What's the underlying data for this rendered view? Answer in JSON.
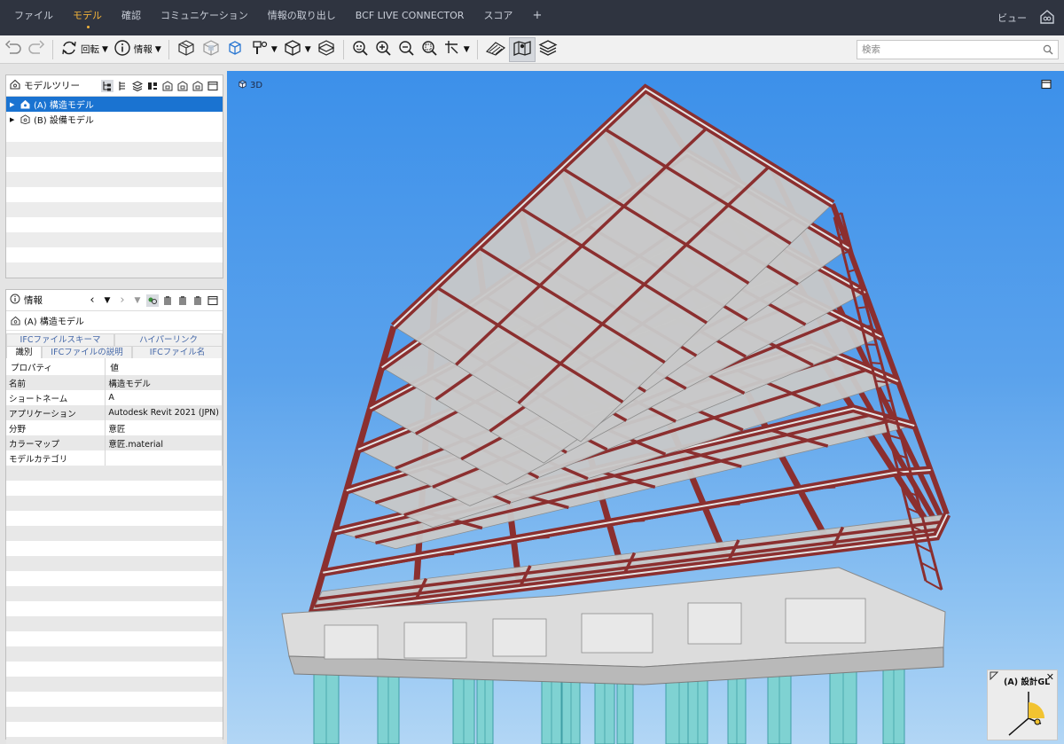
{
  "menu": {
    "items": [
      "ファイル",
      "モデル",
      "確認",
      "コミュニケーション",
      "情報の取り出し",
      "BCF LIVE CONNECTOR",
      "スコア",
      "+"
    ],
    "active_index": 1,
    "view_label": "ビュー"
  },
  "toolbar": {
    "rotate_label": "回転",
    "info_label": "情報",
    "search_placeholder": "検索"
  },
  "model_tree": {
    "title": "モデルツリー",
    "items": [
      {
        "label": "(A) 構造モデル",
        "selected": true
      },
      {
        "label": "(B) 設備モデル",
        "selected": false
      }
    ]
  },
  "info_panel": {
    "title": "情報",
    "selection_label": "(A) 構造モデル",
    "tabs_row1": [
      "IFCファイルスキーマ",
      "ハイパーリンク"
    ],
    "tabs_row2": [
      "識別",
      "IFCファイルの説明",
      "IFCファイル名"
    ],
    "active_tab": "識別",
    "property_header": "プロパティ",
    "value_header": "値",
    "properties": [
      {
        "name": "名前",
        "value": "構造モデル"
      },
      {
        "name": "ショートネーム",
        "value": "A"
      },
      {
        "name": "アプリケーション",
        "value": "Autodesk Revit 2021 (JPN)"
      },
      {
        "name": "分野",
        "value": "意匠"
      },
      {
        "name": "カラーマップ",
        "value": "意匠.material"
      },
      {
        "name": "モデルカテゴリ",
        "value": ""
      }
    ]
  },
  "viewport": {
    "mode_label": "3D",
    "level_label": "(A) 設計GL"
  },
  "colors": {
    "menubar_bg": "#2f3440",
    "active_accent": "#f2b33a",
    "selection_blue": "#1a73d1",
    "steel_red": "#8b2f2f",
    "slab_grey": "#c9c9c9",
    "pile_cyan": "#7fd2d2"
  },
  "icons": [
    "undo-icon",
    "redo-icon",
    "rotate-icon",
    "info-icon",
    "box-icon",
    "section-box-icon",
    "hide-icon",
    "paint-icon",
    "cube-icon",
    "plane-icon",
    "zoom-fit-icon",
    "zoom-in-icon",
    "zoom-out-icon",
    "zoom-area-icon",
    "pointer-icon",
    "measure-icon",
    "map-icon",
    "layers-icon",
    "search-icon",
    "model-home-icon"
  ]
}
